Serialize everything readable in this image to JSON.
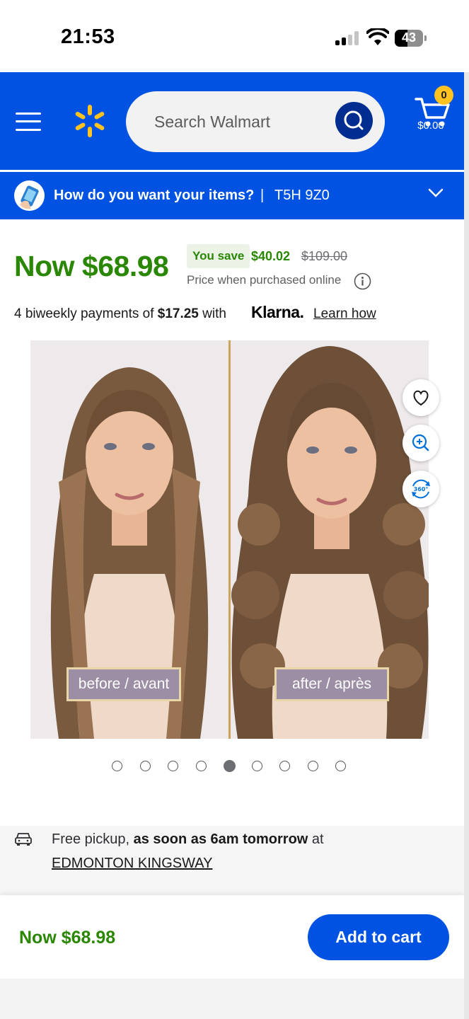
{
  "status_bar": {
    "time": "21:53",
    "battery": "43"
  },
  "header": {
    "search_placeholder": "Search Walmart",
    "cart_count": "0",
    "cart_total": "$0.00"
  },
  "delivery": {
    "question": "How do you want your items?",
    "separator": "|",
    "postal_code": "T5H 9Z0"
  },
  "price": {
    "now": "Now $68.98",
    "you_save_label": "You save",
    "save_amount": "$40.02",
    "was": "$109.00",
    "note": "Price when purchased online"
  },
  "klarna": {
    "prefix": "4 biweekly payments of ",
    "amount": "$17.25",
    "suffix": " with",
    "brand": "Klarna.",
    "learn_how": "Learn how"
  },
  "gallery": {
    "before_label": "before / avant",
    "after_label": "after / après",
    "total_images": 9,
    "active_index": 4
  },
  "pickup": {
    "prefix": "Free pickup, ",
    "emphasis": "as soon as 6am tomorrow",
    "suffix": " at",
    "store": "EDMONTON KINGSWAY"
  },
  "sticky": {
    "price": "Now $68.98",
    "add_to_cart": "Add to cart"
  },
  "colors": {
    "brand_blue": "#0053e2",
    "spark_yellow": "#ffc220",
    "price_green": "#2a8703"
  }
}
